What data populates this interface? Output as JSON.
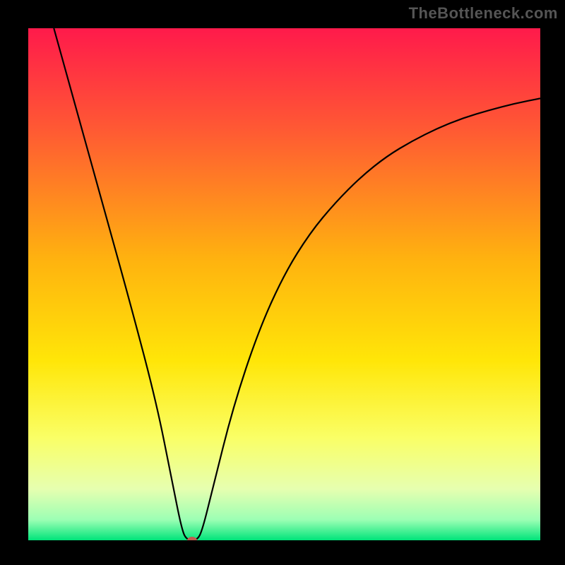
{
  "watermark": "TheBottleneck.com",
  "chart_data": {
    "type": "line",
    "title": "",
    "xlabel": "",
    "ylabel": "",
    "xlim": [
      0,
      100
    ],
    "ylim": [
      0,
      100
    ],
    "background_gradient": {
      "stops": [
        {
          "offset": 0,
          "color": "#ff1a4b"
        },
        {
          "offset": 20,
          "color": "#ff5a33"
        },
        {
          "offset": 45,
          "color": "#ffb20f"
        },
        {
          "offset": 65,
          "color": "#ffe608"
        },
        {
          "offset": 80,
          "color": "#faff66"
        },
        {
          "offset": 90,
          "color": "#e6ffb0"
        },
        {
          "offset": 96,
          "color": "#9cffb4"
        },
        {
          "offset": 100,
          "color": "#00e47a"
        }
      ]
    },
    "marker": {
      "x": 32,
      "y": 0,
      "color": "#c05a50"
    },
    "series": [
      {
        "name": "bottleneck-curve",
        "color": "#000000",
        "points": [
          {
            "x": 5,
            "y": 100
          },
          {
            "x": 10,
            "y": 82
          },
          {
            "x": 15,
            "y": 64
          },
          {
            "x": 20,
            "y": 46
          },
          {
            "x": 25,
            "y": 27
          },
          {
            "x": 28,
            "y": 12
          },
          {
            "x": 30,
            "y": 2
          },
          {
            "x": 31,
            "y": 0
          },
          {
            "x": 33,
            "y": 0
          },
          {
            "x": 34,
            "y": 2
          },
          {
            "x": 36,
            "y": 10
          },
          {
            "x": 40,
            "y": 26
          },
          {
            "x": 45,
            "y": 41
          },
          {
            "x": 50,
            "y": 52
          },
          {
            "x": 55,
            "y": 60
          },
          {
            "x": 60,
            "y": 66
          },
          {
            "x": 65,
            "y": 71
          },
          {
            "x": 70,
            "y": 75
          },
          {
            "x": 75,
            "y": 78
          },
          {
            "x": 80,
            "y": 80.5
          },
          {
            "x": 85,
            "y": 82.5
          },
          {
            "x": 90,
            "y": 84
          },
          {
            "x": 95,
            "y": 85.3
          },
          {
            "x": 100,
            "y": 86.3
          }
        ]
      }
    ]
  }
}
